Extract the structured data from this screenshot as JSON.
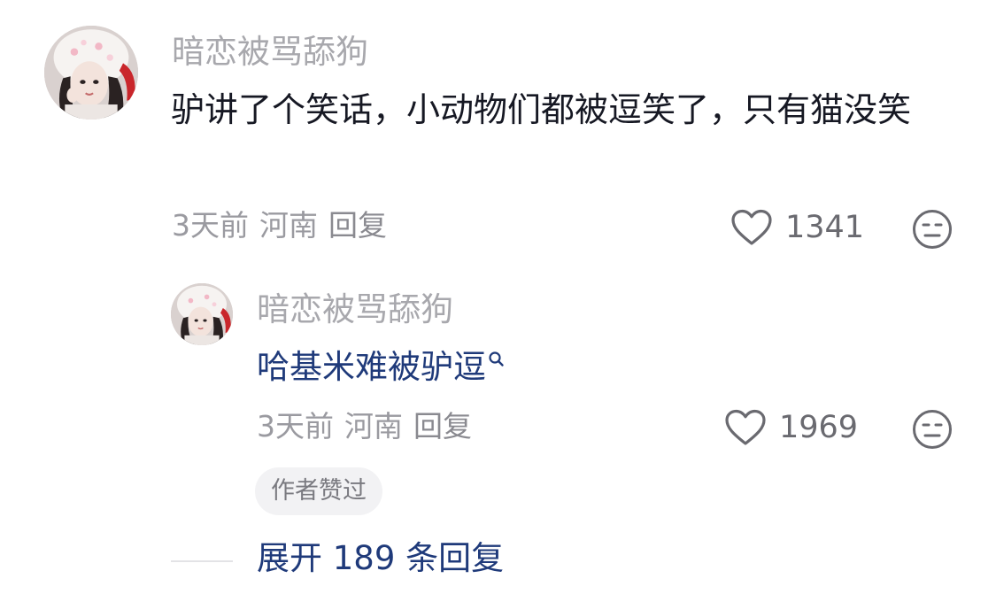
{
  "comment": {
    "username": "暗恋被骂舔狗",
    "text": "驴讲了个笑话，小动物们都被逗笑了，只有猫没笑",
    "time": "3天前",
    "location": "河南",
    "reply_label": "回复",
    "like_count": "1341",
    "like_icon": "heart-outline-icon",
    "dislike_icon": "meh-face-icon"
  },
  "reply": {
    "username": "暗恋被骂舔狗",
    "text": "哈基米难被驴逗",
    "search_icon": "search-icon",
    "time": "3天前",
    "location": "河南",
    "reply_label": "回复",
    "like_count": "1969",
    "like_icon": "heart-outline-icon",
    "dislike_icon": "meh-face-icon",
    "author_liked_badge": "作者赞过"
  },
  "expand_replies": "展开 189 条回复",
  "colors": {
    "username": "#a8a8ad",
    "body_text": "#161823",
    "link_blue": "#1f3a7a",
    "meta": "#9a9aa0",
    "badge_bg": "#f2f2f4"
  }
}
